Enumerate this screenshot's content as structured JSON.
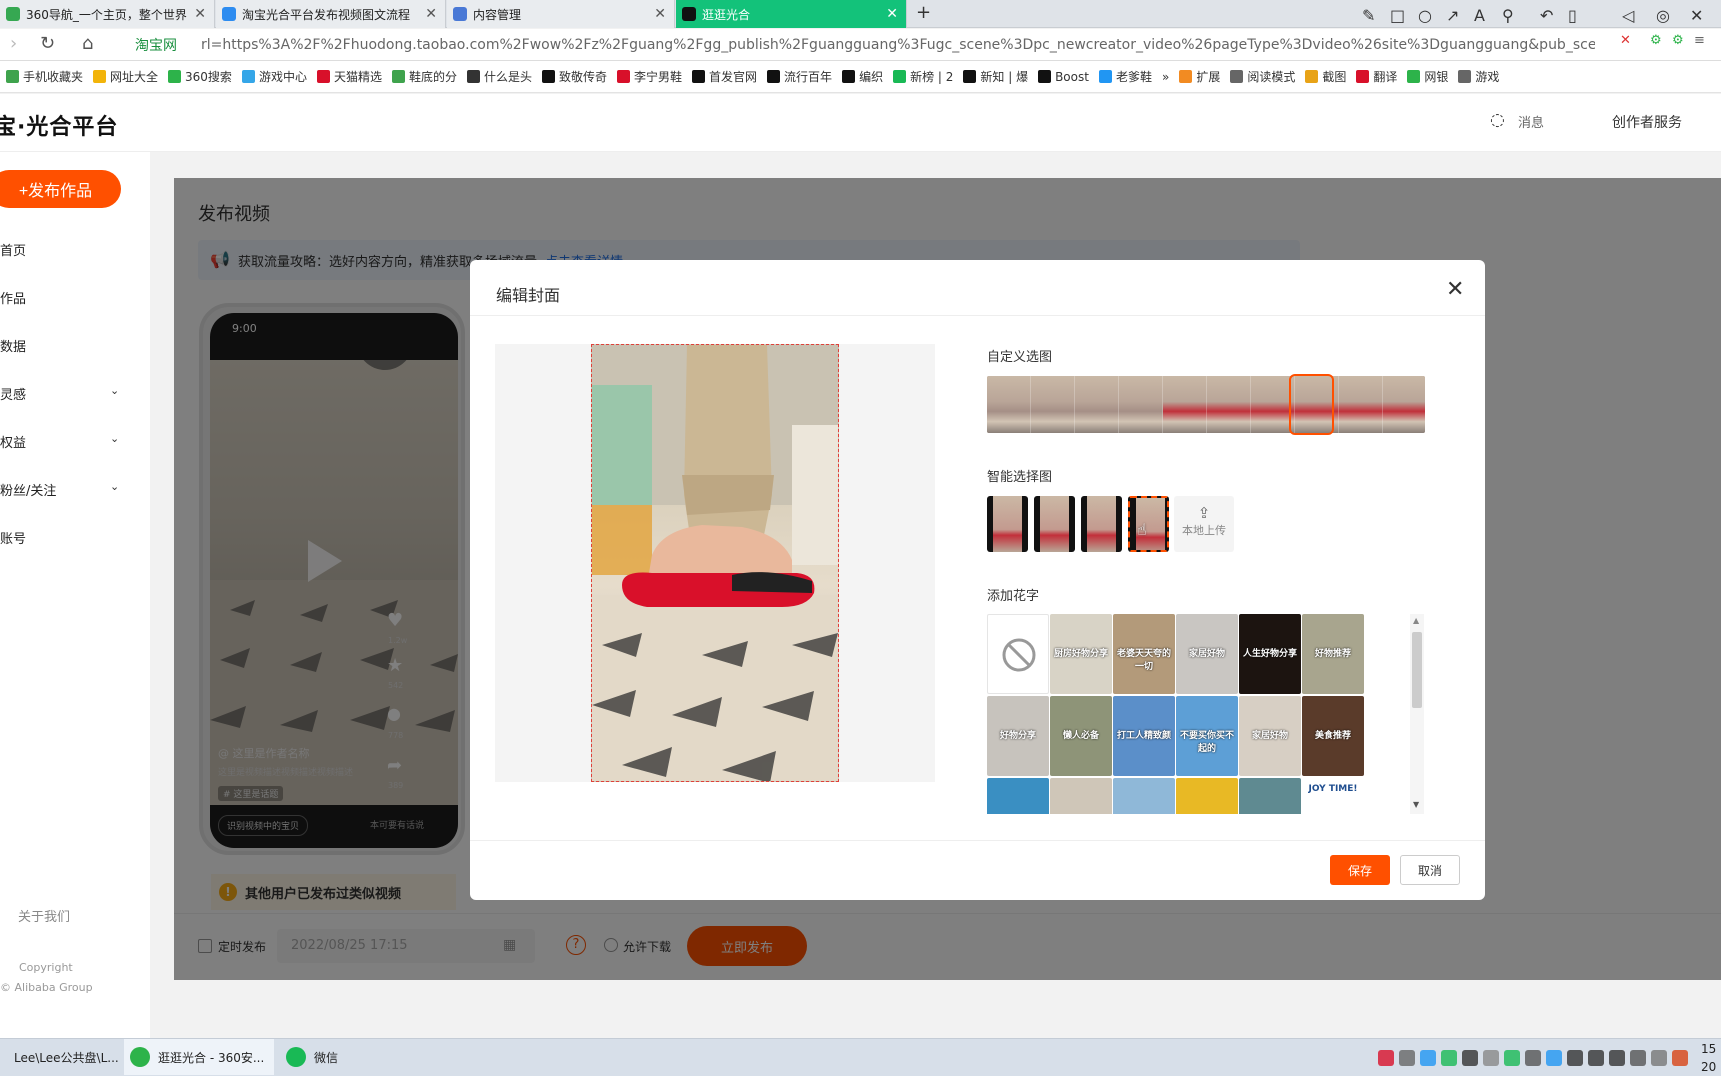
{
  "browser": {
    "tabs": [
      {
        "title": "360导航_一个主页，整个世界",
        "color": "#36a852"
      },
      {
        "title": "淘宝光合平台发布视频图文流程",
        "color": "#2d8cf0"
      },
      {
        "title": "内容管理",
        "color": "#4a79d6"
      },
      {
        "title": "逛逛光合",
        "color": "#111111"
      }
    ],
    "new_tab": "+",
    "url_badge": "淘宝网",
    "url": "rl=https%3A%2F%2Fhuodong.taobao.com%2Fwow%2Fz%2Fguang%2Fgg_publish%2Fguangguang%3Fugc_scene%3Dpc_newcreator_video%26pageType%3Dvideo%26site%3Dguangguang&pub_scene=gg",
    "bookmarks": [
      {
        "label": "手机收藏夹",
        "color": "#3fa34d"
      },
      {
        "label": "网址大全",
        "color": "#f2b40a"
      },
      {
        "label": "360搜索",
        "color": "#2db34a"
      },
      {
        "label": "游戏中心",
        "color": "#35a6e8"
      },
      {
        "label": "天猫精选",
        "color": "#d8102a"
      },
      {
        "label": "鞋底的分",
        "color": "#3fa34d"
      },
      {
        "label": "什么是头",
        "color": "#333333"
      },
      {
        "label": "致敬传奇",
        "color": "#111111"
      },
      {
        "label": "李宁男鞋",
        "color": "#d8102a"
      },
      {
        "label": "首发官网",
        "color": "#111111"
      },
      {
        "label": "流行百年",
        "color": "#111111"
      },
      {
        "label": "编织",
        "color": "#111111"
      },
      {
        "label": "新榜 | 2",
        "color": "#19b955"
      },
      {
        "label": "新知 | 爆",
        "color": "#111111"
      },
      {
        "label": "Boost",
        "color": "#111111"
      },
      {
        "label": "老爹鞋",
        "color": "#2196f3"
      },
      {
        "label": "»",
        "color": ""
      },
      {
        "label": "扩展",
        "color": "#f28b22"
      },
      {
        "label": "阅读模式",
        "color": "#666666"
      },
      {
        "label": "截图",
        "color": "#e8a317"
      },
      {
        "label": "翻译",
        "color": "#d8102a"
      },
      {
        "label": "网银",
        "color": "#2db34a"
      },
      {
        "label": "游戏",
        "color": "#666666"
      }
    ]
  },
  "site": {
    "logo": "宝·光合平台",
    "message": "消息",
    "creator_service": "创作者服务"
  },
  "sidebar": {
    "publish_button": "+发布作品",
    "items": [
      {
        "label": "首页",
        "expandable": false
      },
      {
        "label": "作品",
        "expandable": false
      },
      {
        "label": "数据",
        "expandable": false
      },
      {
        "label": "灵感",
        "expandable": true
      },
      {
        "label": "权益",
        "expandable": true
      },
      {
        "label": "粉丝/关注",
        "expandable": true
      },
      {
        "label": "账号",
        "expandable": false
      }
    ],
    "about": "关于我们",
    "copyright": "Copyright",
    "company": "© Alibaba Group"
  },
  "main": {
    "title": "发布视频",
    "tip": "获取流量攻略：选好内容方向，精准获取多场域流量",
    "tip_link": "点击查看详情",
    "phone": {
      "time": "9:00",
      "author": "@ 这里是作者名称",
      "desc": "这里是视频描述视频描述视频描述",
      "tag": "# 这里是话题",
      "scan": "识别视频中的宝贝",
      "comment": "本可要有话说",
      "stats": [
        "1.2w",
        "542",
        "778",
        "389"
      ]
    },
    "similar_notice": "其他用户已发布过类似视频"
  },
  "actionbar": {
    "schedule_label": "定时发布",
    "date_value": "2022/08/25 17:15",
    "download_label": "允许下载",
    "publish_now": "立即发布"
  },
  "modal": {
    "title": "编辑封面",
    "custom_select_label": "自定义选图",
    "smart_select_label": "智能选择图",
    "upload_label": "本地上传",
    "flower_text_label": "添加花字",
    "flower_texts": [
      "",
      "厨房好物分享",
      "老婆天天夸的一切",
      "家居好物",
      "人生好物分享",
      "好物推荐",
      "好物分享",
      "懒人必备",
      "打工人精致颜",
      "不要买你买不起的",
      "家居好物",
      "美食推荐",
      "",
      "",
      "",
      "",
      "",
      "JOY TIME!"
    ],
    "save": "保存",
    "cancel": "取消",
    "accent": "#ff5000"
  },
  "taskbar": {
    "items": [
      {
        "label": "Lee\\Lee公共盘\\L...",
        "color": "#1e88e5"
      },
      {
        "label": "逛逛光合 - 360安...",
        "color": "#2db34a"
      },
      {
        "label": "微信",
        "color": "#19b955"
      }
    ],
    "clock_line1": "15",
    "clock_line2": "20"
  }
}
